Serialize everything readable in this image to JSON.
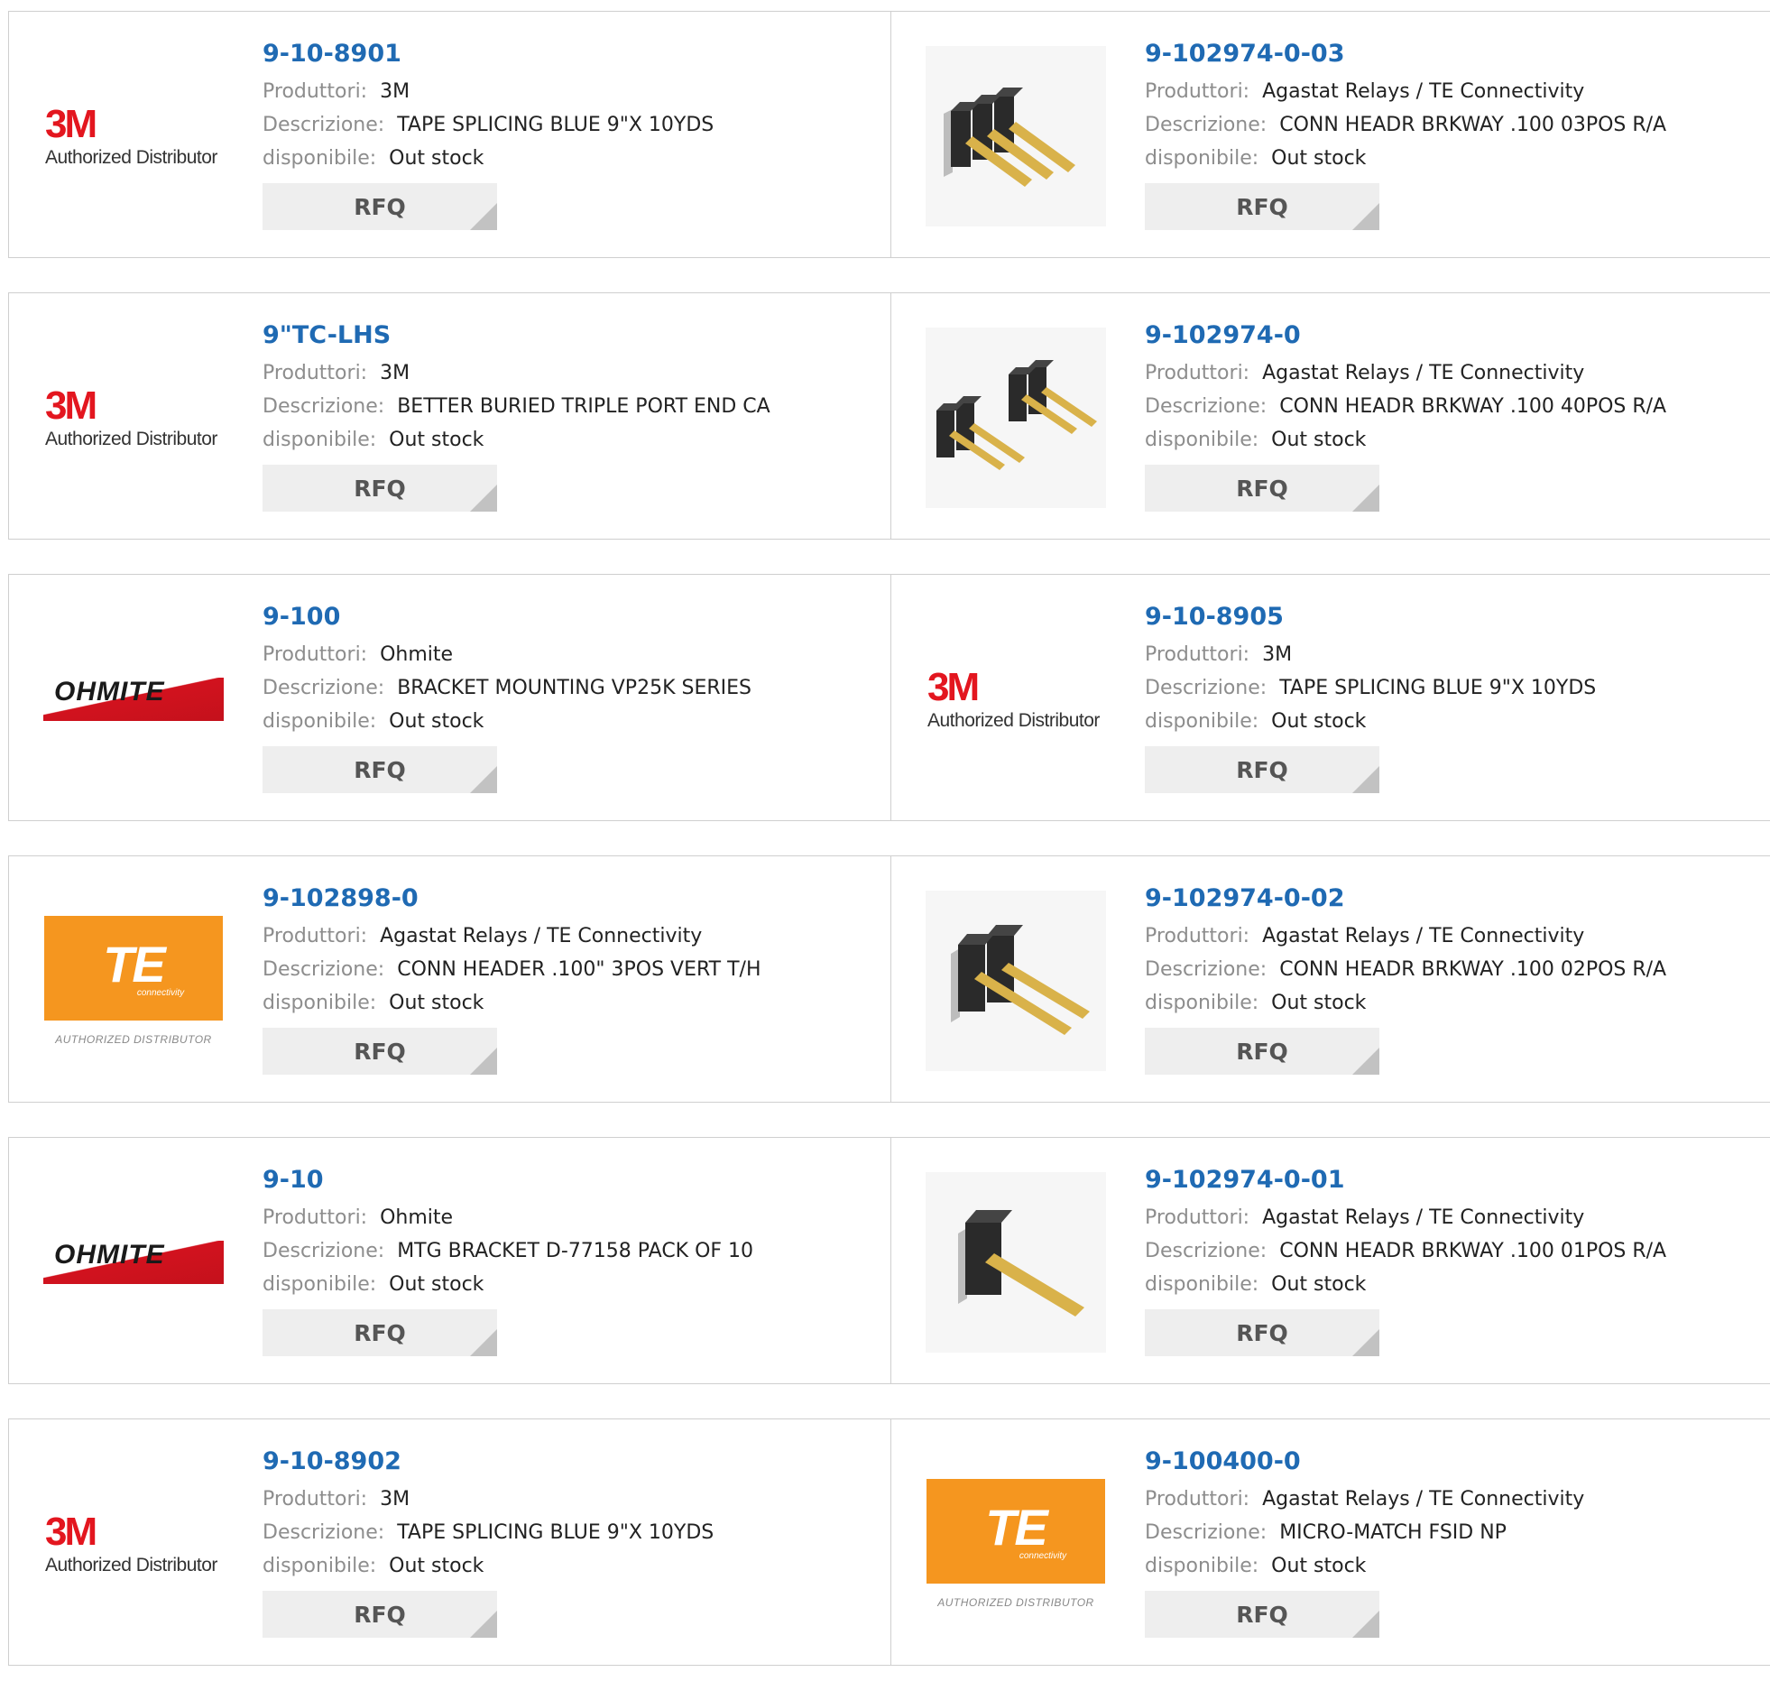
{
  "labels": {
    "manufacturer": "Produttori:",
    "description": "Descrizione:",
    "availability": "disponibile:",
    "rfq": "RFQ"
  },
  "logos": {
    "3m": {
      "mark": "3M",
      "sub": "Authorized Distributor"
    },
    "ohmite": {
      "text": "OHMITE"
    },
    "te": {
      "mark": "TE",
      "sub": "connectivity",
      "auth": "AUTHORIZED DISTRIBUTOR"
    }
  },
  "colors": {
    "part_number": "#1f6ab3",
    "rfq_bg": "#eeeeee",
    "logo_3m": "#e3161f",
    "logo_te": "#f5961f",
    "logo_ohmite": "#d2121e"
  },
  "products": [
    {
      "part": "9-10-8901",
      "manufacturer": "3M",
      "description": "TAPE SPLICING BLUE 9\"X 10YDS",
      "availability": "Out stock",
      "thumbnail": "3m-logo"
    },
    {
      "part": "9-102974-0-03",
      "manufacturer": "Agastat Relays / TE Connectivity",
      "description": "CONN HEADR BRKWAY .100 03POS R/A",
      "availability": "Out stock",
      "thumbnail": "header-3pos-image"
    },
    {
      "part": "9\"TC-LHS",
      "manufacturer": "3M",
      "description": "BETTER BURIED TRIPLE PORT END CA",
      "availability": "Out stock",
      "thumbnail": "3m-logo"
    },
    {
      "part": "9-102974-0",
      "manufacturer": "Agastat Relays / TE Connectivity",
      "description": "CONN HEADR BRKWAY .100 40POS R/A",
      "availability": "Out stock",
      "thumbnail": "header-pair-image"
    },
    {
      "part": "9-100",
      "manufacturer": "Ohmite",
      "description": "BRACKET MOUNTING VP25K SERIES",
      "availability": "Out stock",
      "thumbnail": "ohmite-logo"
    },
    {
      "part": "9-10-8905",
      "manufacturer": "3M",
      "description": "TAPE SPLICING BLUE 9\"X 10YDS",
      "availability": "Out stock",
      "thumbnail": "3m-logo"
    },
    {
      "part": "9-102898-0",
      "manufacturer": "Agastat Relays / TE Connectivity",
      "description": "CONN HEADER .100\" 3POS VERT T/H",
      "availability": "Out stock",
      "thumbnail": "te-logo"
    },
    {
      "part": "9-102974-0-02",
      "manufacturer": "Agastat Relays / TE Connectivity",
      "description": "CONN HEADR BRKWAY .100 02POS R/A",
      "availability": "Out stock",
      "thumbnail": "header-2pos-image"
    },
    {
      "part": "9-10",
      "manufacturer": "Ohmite",
      "description": "MTG BRACKET D-77158 PACK OF 10",
      "availability": "Out stock",
      "thumbnail": "ohmite-logo"
    },
    {
      "part": "9-102974-0-01",
      "manufacturer": "Agastat Relays / TE Connectivity",
      "description": "CONN HEADR BRKWAY .100 01POS R/A",
      "availability": "Out stock",
      "thumbnail": "header-1pos-image"
    },
    {
      "part": "9-10-8902",
      "manufacturer": "3M",
      "description": "TAPE SPLICING BLUE 9\"X 10YDS",
      "availability": "Out stock",
      "thumbnail": "3m-logo"
    },
    {
      "part": "9-100400-0",
      "manufacturer": "Agastat Relays / TE Connectivity",
      "description": "MICRO-MATCH FSID NP",
      "availability": "Out stock",
      "thumbnail": "te-logo"
    }
  ]
}
